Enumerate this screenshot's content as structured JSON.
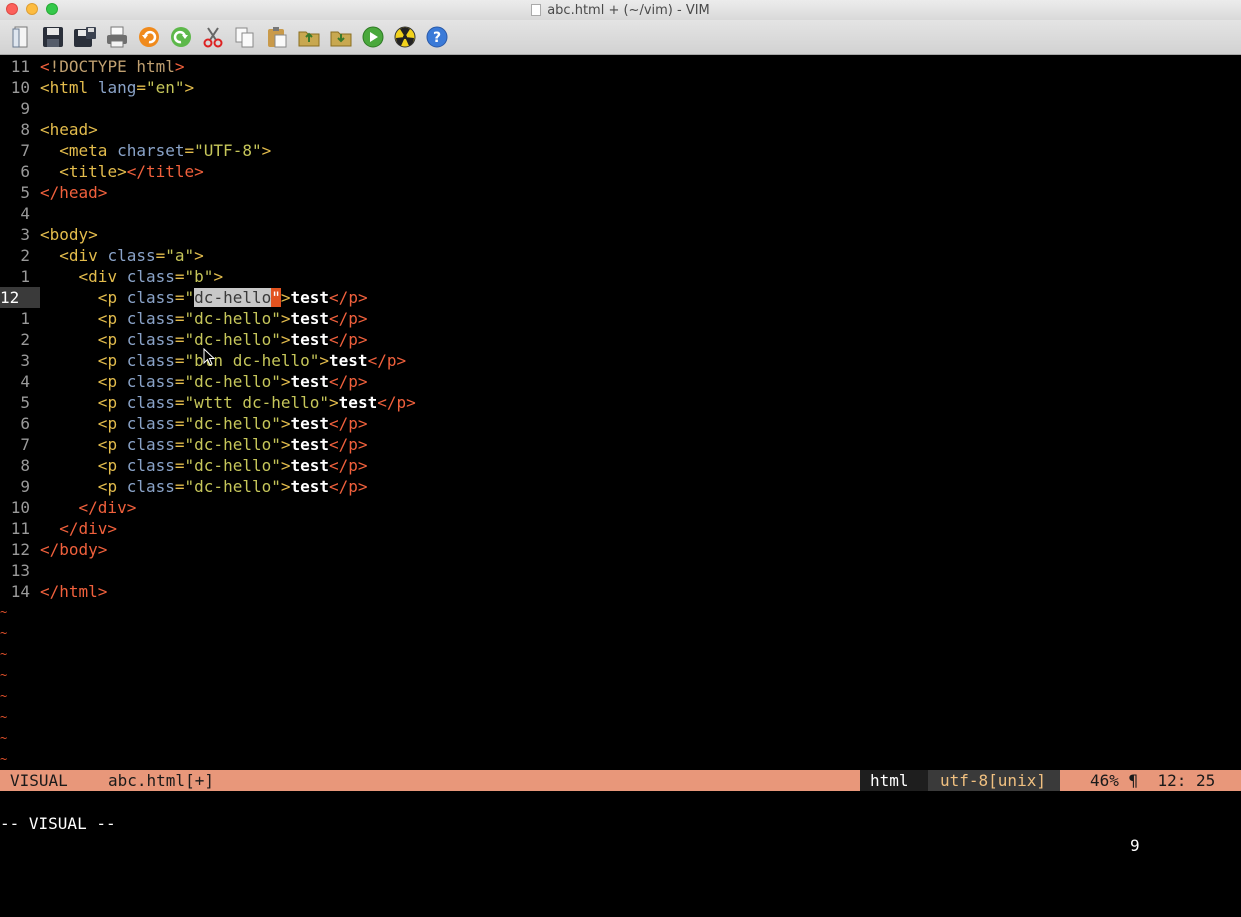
{
  "window": {
    "title": "abc.html + (~/vim) - VIM"
  },
  "toolbar": {
    "buttons": [
      {
        "name": "open-icon",
        "label": "Open"
      },
      {
        "name": "save-icon",
        "label": "Save"
      },
      {
        "name": "save-all-icon",
        "label": "Save All"
      },
      {
        "name": "print-icon",
        "label": "Print"
      },
      {
        "name": "undo-icon",
        "label": "Undo"
      },
      {
        "name": "redo-icon",
        "label": "Redo"
      },
      {
        "name": "cut-icon",
        "label": "Cut"
      },
      {
        "name": "copy-icon",
        "label": "Copy"
      },
      {
        "name": "paste-icon",
        "label": "Paste"
      },
      {
        "name": "load-session-icon",
        "label": "Load Session"
      },
      {
        "name": "save-session-icon",
        "label": "Save Session"
      },
      {
        "name": "run-script-icon",
        "label": "Run Script"
      },
      {
        "name": "make-icon",
        "label": "Make"
      },
      {
        "name": "help-icon",
        "label": "Help"
      }
    ]
  },
  "editor": {
    "current_line_number": "12",
    "lines": [
      {
        "n": "11",
        "code": "<!DOCTYPE html>"
      },
      {
        "n": "10",
        "code": "<html lang=\"en\">"
      },
      {
        "n": "9",
        "code": ""
      },
      {
        "n": "8",
        "code": "<head>"
      },
      {
        "n": "7",
        "code": "  <meta charset=\"UTF-8\">"
      },
      {
        "n": "6",
        "code": "  <title></title>"
      },
      {
        "n": "5",
        "code": "</head>"
      },
      {
        "n": "4",
        "code": ""
      },
      {
        "n": "3",
        "code": "<body>"
      },
      {
        "n": "2",
        "code": "  <div class=\"a\">"
      },
      {
        "n": "1",
        "code": "    <div class=\"b\">"
      },
      {
        "n": "12",
        "code": "      <p class=\"dc-hello\">test</p>",
        "current": true
      },
      {
        "n": "1",
        "code": "      <p class=\"dc-hello\">test</p>"
      },
      {
        "n": "2",
        "code": "      <p class=\"dc-hello\">test</p>"
      },
      {
        "n": "3",
        "code": "      <p class=\"btn dc-hello\">test</p>"
      },
      {
        "n": "4",
        "code": "      <p class=\"dc-hello\">test</p>"
      },
      {
        "n": "5",
        "code": "      <p class=\"wttt dc-hello\">test</p>"
      },
      {
        "n": "6",
        "code": "      <p class=\"dc-hello\">test</p>"
      },
      {
        "n": "7",
        "code": "      <p class=\"dc-hello\">test</p>"
      },
      {
        "n": "8",
        "code": "      <p class=\"dc-hello\">test</p>"
      },
      {
        "n": "9",
        "code": "      <p class=\"dc-hello\">test</p>"
      },
      {
        "n": "10",
        "code": "    </div>"
      },
      {
        "n": "11",
        "code": "  </div>"
      },
      {
        "n": "12",
        "code": "</body>"
      },
      {
        "n": "13",
        "code": ""
      },
      {
        "n": "14",
        "code": "</html>"
      }
    ],
    "tilde_lines": 8,
    "tilde_char": "~",
    "selection": {
      "text": "dc-hello",
      "cursor_char": "\""
    }
  },
  "statusline": {
    "mode": "VISUAL",
    "file": "abc.html[+]",
    "filetype": "html",
    "encoding": "utf-8[unix]",
    "percent": "46%",
    "pilcrow": "¶",
    "position": "12: 25"
  },
  "cmdline": {
    "mode_text": "-- VISUAL --",
    "count": "9"
  },
  "colors": {
    "background": "#000000",
    "statusline": "#e8977a",
    "tag": "#e3bc4c",
    "close_tag": "#f0603c",
    "attribute": "#8aa3c8",
    "string": "#c6c65a",
    "tilde": "#e0502a",
    "cursor": "#e2531f"
  }
}
